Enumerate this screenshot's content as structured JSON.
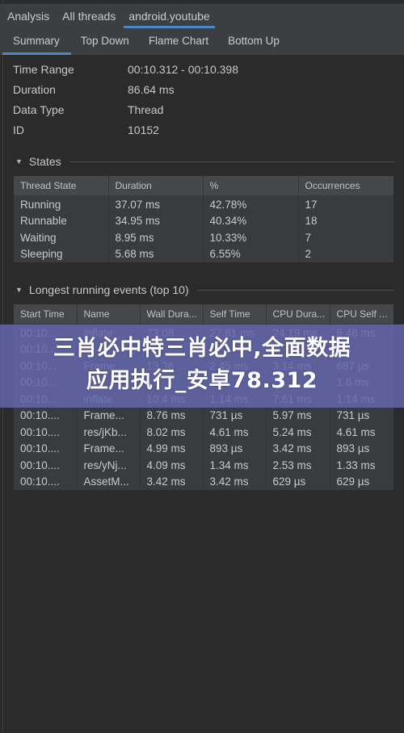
{
  "top_tabs": [
    {
      "label": "Analysis",
      "active": false
    },
    {
      "label": "All threads",
      "active": false
    },
    {
      "label": "android.youtube",
      "active": true
    }
  ],
  "sub_tabs": [
    {
      "label": "Summary",
      "active": true
    },
    {
      "label": "Top Down",
      "active": false
    },
    {
      "label": "Flame Chart",
      "active": false
    },
    {
      "label": "Bottom Up",
      "active": false
    }
  ],
  "summary": [
    {
      "label": "Time Range",
      "value": "00:10.312 - 00:10.398"
    },
    {
      "label": "Duration",
      "value": "86.64 ms"
    },
    {
      "label": "Data Type",
      "value": "Thread"
    },
    {
      "label": "ID",
      "value": "10152"
    }
  ],
  "states": {
    "title": "States",
    "columns": [
      "Thread State",
      "Duration",
      "%",
      "Occurrences"
    ],
    "rows": [
      [
        "Running",
        "37.07 ms",
        "42.78%",
        "17"
      ],
      [
        "Runnable",
        "34.95 ms",
        "40.34%",
        "18"
      ],
      [
        "Waiting",
        "8.95 ms",
        "10.33%",
        "7"
      ],
      [
        "Sleeping",
        "5.68 ms",
        "6.55%",
        "2"
      ]
    ]
  },
  "events": {
    "title": "Longest running events (top 10)",
    "columns": [
      "Start Time",
      "Name",
      "Wall Dura...",
      "Self Time",
      "CPU Dura...",
      "CPU Self ..."
    ],
    "rows": [
      [
        "00:10....",
        "inflate",
        "73.08 ...",
        "27.81 ms",
        "24.19 ms",
        "6.46 ms"
      ],
      [
        "00:10....",
        "",
        "",
        "",
        "",
        "ms"
      ],
      [
        "00:10....",
        "Frame...",
        "13.36 ...",
        "2.45 ms",
        "3.14 ms",
        "687 µs"
      ],
      [
        "00:10....",
        "",
        "",
        "",
        "",
        "1.8 ms"
      ],
      [
        "00:10....",
        "inflate",
        "10.4 ms",
        "1.14 ms",
        "7.61 ms",
        "1.14 ms"
      ],
      [
        "00:10....",
        "Frame...",
        "8.76 ms",
        "731 µs",
        "5.97 ms",
        "731 µs"
      ],
      [
        "00:10....",
        "res/jKb...",
        "8.02 ms",
        "4.61 ms",
        "5.24 ms",
        "4.61 ms"
      ],
      [
        "00:10....",
        "Frame...",
        "4.99 ms",
        "893 µs",
        "3.42 ms",
        "893 µs"
      ],
      [
        "00:10....",
        "res/yNj...",
        "4.09 ms",
        "1.34 ms",
        "2.53 ms",
        "1.33 ms"
      ],
      [
        "00:10....",
        "AssetM...",
        "3.42 ms",
        "3.42 ms",
        "629 µs",
        "629 µs"
      ]
    ]
  },
  "overlay": {
    "line1": "三肖必中特三肖必中,全面数据",
    "line2": "应用执行_安卓78.312"
  },
  "colors": {
    "accent": "#4a88c7",
    "background": "#2b2b2b",
    "panel": "#3c3f41",
    "overlay": "#6466aa"
  }
}
